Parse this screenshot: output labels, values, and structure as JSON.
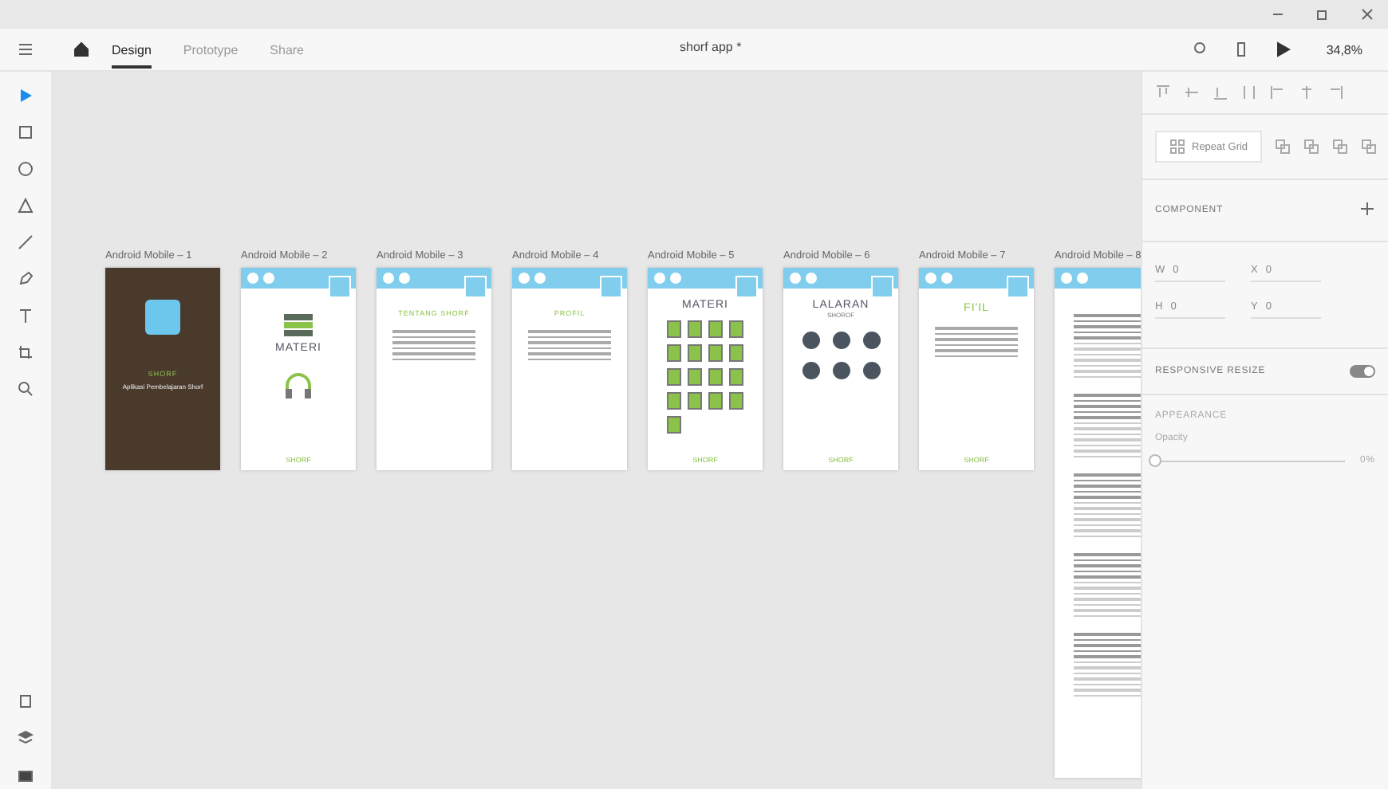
{
  "toolbar": {
    "tabs": [
      {
        "label": "Design",
        "selected": true
      },
      {
        "label": "Prototype",
        "selected": false
      },
      {
        "label": "Share",
        "selected": false
      }
    ],
    "document_title": "shorf app *",
    "zoom": "34,8%"
  },
  "tools": [
    {
      "kind": "select",
      "selected": true
    },
    {
      "kind": "rectangle",
      "selected": false
    },
    {
      "kind": "ellipse",
      "selected": false
    },
    {
      "kind": "polygon",
      "selected": false
    },
    {
      "kind": "line",
      "selected": false
    },
    {
      "kind": "pen",
      "selected": false
    },
    {
      "kind": "text",
      "selected": false
    },
    {
      "kind": "artboard",
      "selected": false
    },
    {
      "kind": "zoom",
      "selected": false
    }
  ],
  "artboards": [
    {
      "label": "Android Mobile – 1",
      "kind": "splash",
      "title": "SHORF",
      "subtitle": "Aplikasi Pembelajaran Shorf"
    },
    {
      "label": "Android Mobile – 2",
      "kind": "menu",
      "title": "MATERI",
      "footer": "SHORF"
    },
    {
      "label": "Android Mobile – 3",
      "kind": "text",
      "title": "TENTANG SHORF"
    },
    {
      "label": "Android Mobile – 4",
      "kind": "text",
      "title": "PROFIL"
    },
    {
      "label": "Android Mobile – 5",
      "kind": "grid",
      "title": "MATERI",
      "footer": "SHORF"
    },
    {
      "label": "Android Mobile – 6",
      "kind": "audio",
      "title": "LALARAN",
      "subtitle": "SHOROF",
      "footer": "SHORF"
    },
    {
      "label": "Android Mobile – 7",
      "kind": "info",
      "title": "FI'IL",
      "footer": "SHORF"
    },
    {
      "label": "Android Mobile – 8",
      "kind": "table"
    }
  ],
  "panel": {
    "repeat_grid": "Repeat Grid",
    "component": "COMPONENT",
    "fields": [
      {
        "label": "W",
        "value": "0"
      },
      {
        "label": "X",
        "value": "0"
      },
      {
        "label": "H",
        "value": "0"
      },
      {
        "label": "Y",
        "value": "0"
      }
    ],
    "responsive_resize": {
      "label": "RESPONSIVE RESIZE",
      "on": true
    },
    "appearance": "APPEARANCE",
    "opacity": {
      "label": "Opacity",
      "level": 0,
      "reading": "0%"
    }
  }
}
